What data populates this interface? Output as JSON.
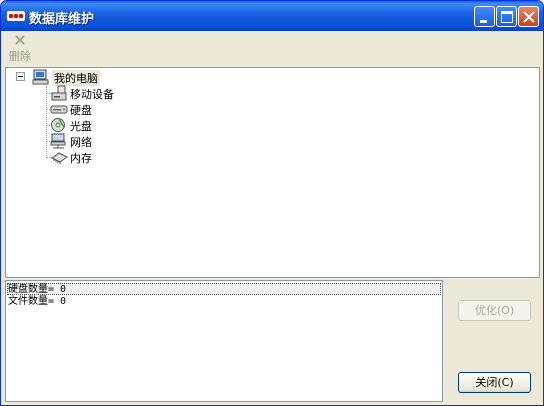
{
  "window": {
    "title": "数据库维护"
  },
  "toolbar": {
    "delete_label": "删除"
  },
  "tree": {
    "root": {
      "label": "我的电脑"
    },
    "children": [
      {
        "label": "移动设备",
        "icon": "removable-device-icon"
      },
      {
        "label": "硬盘",
        "icon": "hard-disk-icon"
      },
      {
        "label": "光盘",
        "icon": "cd-disc-icon"
      },
      {
        "label": "网络",
        "icon": "network-icon"
      },
      {
        "label": "内存",
        "icon": "memory-icon"
      }
    ]
  },
  "info": {
    "lines": [
      "硬盘数量= 0",
      "文件数量= 0"
    ]
  },
  "buttons": {
    "optimize": "优化(O)",
    "close": "关闭(C)"
  },
  "colors": {
    "titlebar": "#0a4fd6",
    "window_bg": "#ece9d8",
    "close_btn": "#c6431f"
  }
}
